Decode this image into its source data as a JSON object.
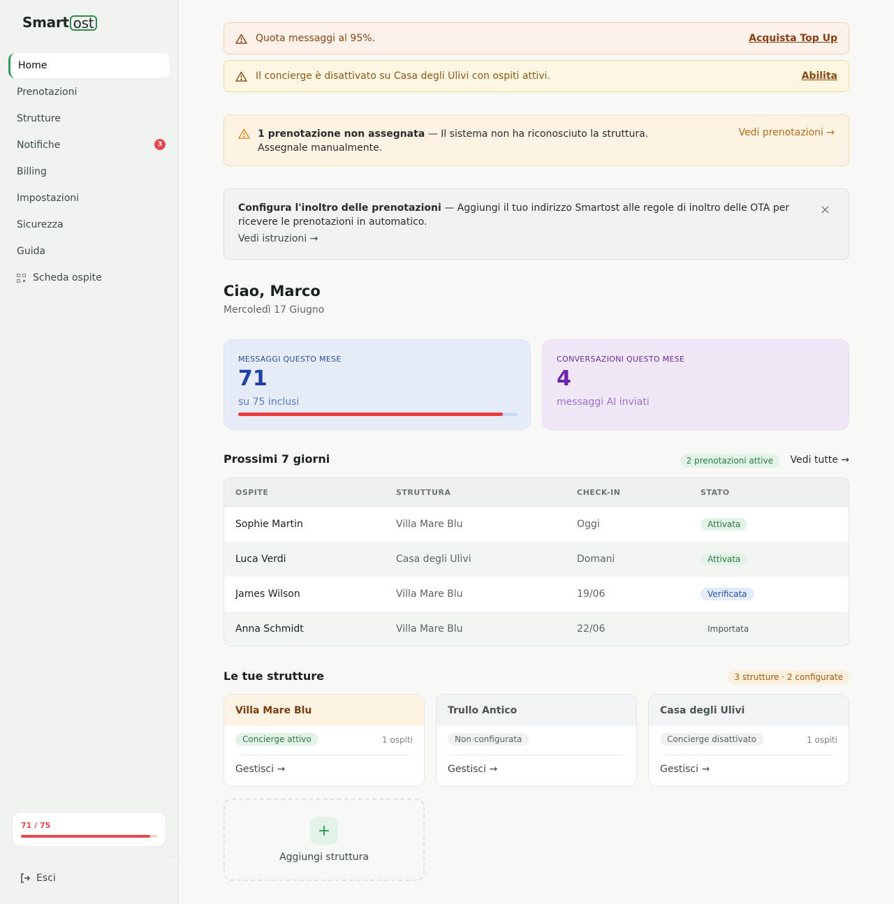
{
  "brand": {
    "smart": "Smart",
    "ost": "ost"
  },
  "nav": [
    {
      "label": "Home",
      "active": true
    },
    {
      "label": "Prenotazioni"
    },
    {
      "label": "Strutture"
    },
    {
      "label": "Notifiche",
      "badge": "3"
    },
    {
      "label": "Billing"
    },
    {
      "label": "Impostazioni"
    },
    {
      "label": "Sicurezza"
    },
    {
      "label": "Guida"
    },
    {
      "label": "Scheda ospite",
      "icon": "qr-code-icon"
    }
  ],
  "quota": {
    "text": "71 / 75",
    "fraction": 0.9467
  },
  "logout_label": "Esci",
  "alerts": {
    "quota": {
      "message": "Quota messaggi al 95%.",
      "action": "Acquista Top Up"
    },
    "concierge": {
      "message": "Il concierge è disattivato su Casa degli Ulivi con ospiti attivi.",
      "action": "Abilita"
    },
    "unassigned": {
      "title": "1 prenotazione non assegnata",
      "message": " — Il sistema non ha riconosciuto la struttura. Assegnale manualmente.",
      "action": "Vedi prenotazioni →"
    },
    "forwarding": {
      "title": "Configura l'inoltro delle prenotazioni",
      "message": " — Aggiungi il tuo indirizzo Smartost alle regole di inoltro delle OTA per ricevere le prenotazioni in automatico.",
      "link": "Vedi istruzioni →",
      "close": "×"
    }
  },
  "greeting": "Ciao, Marco",
  "date": "Mercoledì 17 Giugno",
  "stats": {
    "messages": {
      "label": "MESSAGGI QUESTO MESE",
      "value": "71",
      "sub": "su 75 inclusi",
      "fraction": 0.9467
    },
    "conversations": {
      "label": "CONVERSAZIONI QUESTO MESE",
      "value": "4",
      "sub": "messaggi AI inviati"
    }
  },
  "upcoming": {
    "title": "Prossimi 7 giorni",
    "pill": "2 prenotazioni attive",
    "link": "Vedi tutte →",
    "columns": [
      "OSPITE",
      "STRUTTURA",
      "CHECK-IN",
      "STATO"
    ],
    "rows": [
      {
        "guest": "Sophie Martin",
        "property": "Villa Mare Blu",
        "checkin": "Oggi",
        "status": "Attivata"
      },
      {
        "guest": "Luca Verdi",
        "property": "Casa degli Ulivi",
        "checkin": "Domani",
        "status": "Attivata"
      },
      {
        "guest": "James Wilson",
        "property": "Villa Mare Blu",
        "checkin": "19/06",
        "status": "Verificata"
      },
      {
        "guest": "Anna Schmidt",
        "property": "Villa Mare Blu",
        "checkin": "22/06",
        "status": "Importata"
      }
    ]
  },
  "properties": {
    "title": "Le tue strutture",
    "pill": "3 strutture · 2 configurate",
    "cards": [
      {
        "name": "Villa Mare Blu",
        "status": "Concierge attivo",
        "guests": "1 ospiti",
        "action": "Gestisci →"
      },
      {
        "name": "Trullo Antico",
        "status": "Non configurata",
        "guests": "",
        "action": "Gestisci →"
      },
      {
        "name": "Casa degli Ulivi",
        "status": "Concierge disattivato",
        "guests": "1 ospiti",
        "action": "Gestisci →"
      }
    ],
    "add": {
      "icon": "+",
      "label": "Aggiungi struttura"
    }
  },
  "colors": {
    "accent": "#2f9a58",
    "danger": "#e5484d",
    "warning": "#b86a14"
  }
}
